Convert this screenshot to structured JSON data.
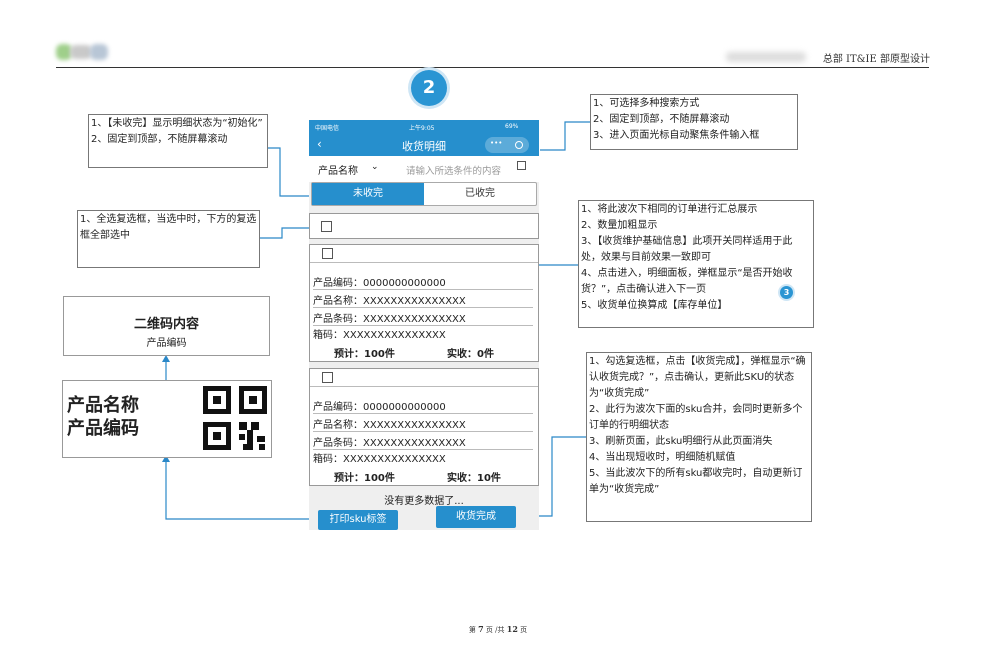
{
  "header": {
    "right_text": "总部 IT&IE 部原型设计"
  },
  "badges": {
    "main": "2",
    "small": "3"
  },
  "phone": {
    "status_carrier": "中国电信",
    "status_time": "上午9:05",
    "status_battery": "69%",
    "title": "收货明细",
    "capsule_more": "•••",
    "search_type": "产品名称",
    "search_placeholder": "请输入所选条件的内容",
    "tab_active": "未收完",
    "tab_inactive": "已收完",
    "items": [
      {
        "code": "产品编码：0000000000000",
        "name": "产品名称：XXXXXXXXXXXXXXX",
        "barcode": "产品条码：XXXXXXXXXXXXXXX",
        "box": "箱码：XXXXXXXXXXXXXXX",
        "expected": "预计：100件",
        "received": "实收：0件"
      },
      {
        "code": "产品编码：0000000000000",
        "name": "产品名称：XXXXXXXXXXXXXXX",
        "barcode": "产品条码：XXXXXXXXXXXXXXX",
        "box": "箱码：XXXXXXXXXXXXXXX",
        "expected": "预计：100件",
        "received": "实收：10件"
      }
    ],
    "no_more": "没有更多数据了...",
    "print_button": "打印sku标签",
    "complete_button": "收货完成"
  },
  "notes": {
    "tab_note": [
      "1、【未收完】显示明细状态为“初始化”",
      "2、固定到顶部，不随屏幕滚动"
    ],
    "select_all_note": [
      "1、全选复选框，当选中时，下方的复选框全部选中"
    ],
    "search_note": [
      "1、可选择多种搜索方式",
      "2、固定到顶部，不随屏幕滚动",
      "3、进入页面光标自动聚焦条件输入框"
    ],
    "summary_note": [
      "1、将此波次下相同的订单进行汇总展示",
      "2、数量加粗显示",
      "3、【收货维护基础信息】此项开关同样适用于此处，效果与目前效果一致即可",
      "4、点击进入，明细面板，弹框显示“是否开始收货？”，点击确认进入下一页",
      "5、收货单位换算成【库存单位】"
    ],
    "complete_note": [
      "1、勾选复选框，点击【收货完成】，弹框显示“确认收货完成？”，点击确认，更新此SKU的状态为“收货完成”",
      "2、此行为波次下面的sku合并，会同时更新多个订单的行明细状态",
      "3、刷新页面，此sku明细行从此页面消失",
      "4、当出现短收时，明细随机赋值",
      "5、当此波次下的所有sku都收完时，自动更新订单为“收货完成”"
    ]
  },
  "qr_content": {
    "title": "二维码内容",
    "sub": "产品编码"
  },
  "label": {
    "line1": "产品名称",
    "line2": "产品编码"
  },
  "footer": {
    "pre": "第",
    "page": "7",
    "mid": "页 /共",
    "total": "12",
    "post": "页"
  },
  "colors": {
    "accent": "#268fcd",
    "badge": "#2a95d3",
    "connector": "#2a88c8"
  }
}
